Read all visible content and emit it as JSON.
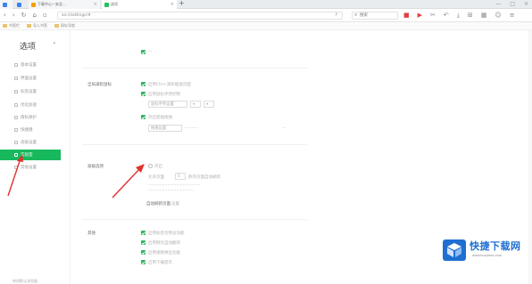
{
  "tabs": [
    {
      "label": "",
      "color": "#3b82f6"
    },
    {
      "label": "",
      "color": "#3b82f6"
    },
    {
      "label": "下载中心—安全…",
      "color": "#f59e0b"
    },
    {
      "label": "选项",
      "color": "#22c55e"
    }
  ],
  "address": {
    "url": "se://settings/#",
    "search_placeholder": "搜索"
  },
  "bookmarks": [
    "书签栏",
    "导入书签",
    "网址导航"
  ],
  "sidebar": {
    "title": "选项",
    "items": [
      {
        "label": "基本设置"
      },
      {
        "label": "界面设置"
      },
      {
        "label": "标签设置"
      },
      {
        "label": "优化加速"
      },
      {
        "label": "隐私保护"
      },
      {
        "label": "快捷键"
      },
      {
        "label": "高级设置"
      },
      {
        "label": "实验室"
      },
      {
        "label": "其他设置"
      }
    ],
    "active_index": 7,
    "footer": "修改默认浏览器"
  },
  "content": {
    "section1": {
      "label": "全局滚轮鼠标",
      "lines": [
        "启用Ctrl+滚轮缩放页面",
        "启用鼠标手势控制",
        "鼠标手势设置",
        "开启智能拖拽",
        "拖拽设置"
      ]
    },
    "section2": {
      "label": "高级选项",
      "lines": [
        "开启",
        "允许页面",
        "秒内页面自动刷新",
        "设置",
        "自动刷新页面"
      ]
    },
    "section3": {
      "label": "其他",
      "lines": [
        "启用标签页预览功能",
        "启用网页自动翻译",
        "启用视频弹出功能",
        "启用下载提示"
      ]
    }
  },
  "colors": {
    "accent": "#18b85c",
    "arrow": "#e0322f",
    "logo": "#1f6fd1"
  },
  "logo": {
    "name": "快捷下载网",
    "url": "www.kuaijiexz.com"
  }
}
